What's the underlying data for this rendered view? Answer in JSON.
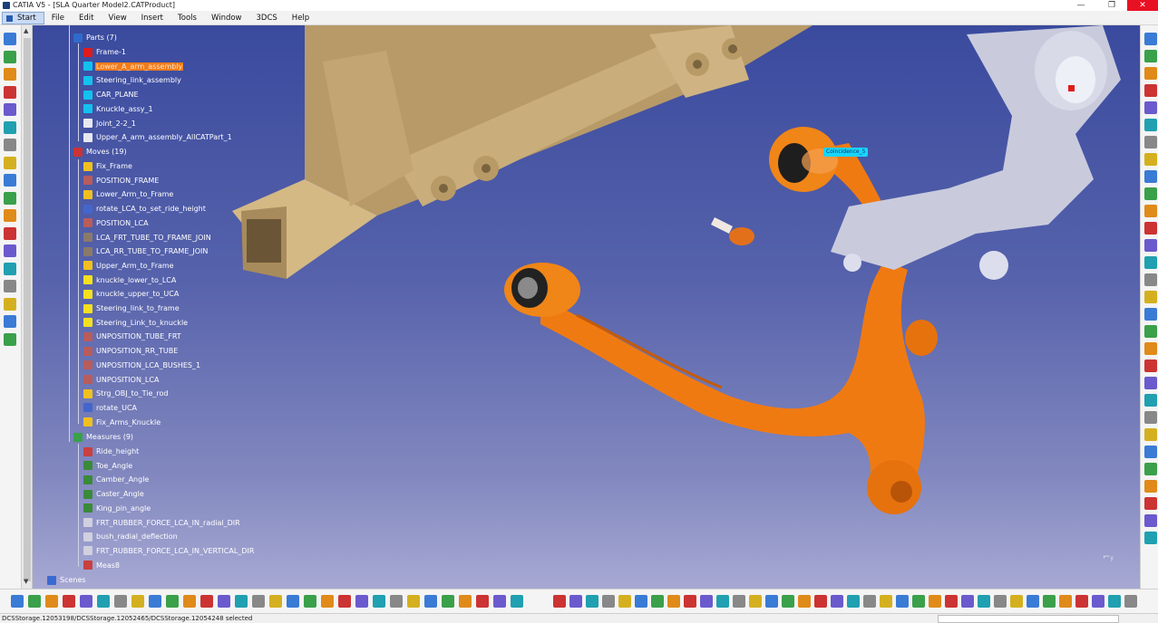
{
  "window": {
    "title": "CATIA V5 - [SLA Quarter Model2.CATProduct]",
    "controls": {
      "minimize": "—",
      "restore": "❐",
      "close": "✕"
    }
  },
  "menu": {
    "items": [
      "Start",
      "File",
      "Edit",
      "View",
      "Insert",
      "Tools",
      "Window",
      "3DCS",
      "Help"
    ]
  },
  "tree": {
    "parts": {
      "label": "Parts (7)",
      "items": [
        {
          "label": "Frame-1",
          "color": "#e01b1b"
        },
        {
          "label": "Lower_A_arm_assembly",
          "color": "#13c1ee",
          "selected": true
        },
        {
          "label": "Steering_link_assembly",
          "color": "#13c1ee"
        },
        {
          "label": "CAR_PLANE",
          "color": "#13c1ee"
        },
        {
          "label": "Knuckle_assy_1",
          "color": "#13c1ee"
        },
        {
          "label": "Joint_2-2_1",
          "color": "#e8e8f0"
        },
        {
          "label": "Upper_A_arm_assembly_AllCATPart_1",
          "color": "#e8e8f0"
        }
      ]
    },
    "moves": {
      "label": "Moves (19)",
      "items": [
        {
          "label": "Fix_Frame",
          "color": "#f0c020"
        },
        {
          "label": "POSITION_FRAME",
          "color": "#b85c5c"
        },
        {
          "label": "Lower_Arm_to_Frame",
          "color": "#f0c020"
        },
        {
          "label": "rotate_LCA_to_set_ride_height",
          "color": "#4466cc"
        },
        {
          "label": "POSITION_LCA",
          "color": "#b85c5c"
        },
        {
          "label": "LCA_FRT_TUBE_TO_FRAME_JOIN",
          "color": "#8a7a6a"
        },
        {
          "label": "LCA_RR_TUBE_TO_FRAME_JOIN",
          "color": "#8a7a6a"
        },
        {
          "label": "Upper_Arm_to_Frame",
          "color": "#f0c020"
        },
        {
          "label": "knuckle_lower_to_LCA",
          "color": "#f5e020"
        },
        {
          "label": "knuckle_upper_to_UCA",
          "color": "#f5e020"
        },
        {
          "label": "Steering_link_to_frame",
          "color": "#f5e020"
        },
        {
          "label": "Steering_Link_to_knuckle",
          "color": "#f5e020"
        },
        {
          "label": "UNPOSITION_TUBE_FRT",
          "color": "#b85c5c"
        },
        {
          "label": "UNPOSITION_RR_TUBE",
          "color": "#b85c5c"
        },
        {
          "label": "UNPOSITION_LCA_BUSHES_1",
          "color": "#b85c5c"
        },
        {
          "label": "UNPOSITION_LCA",
          "color": "#b85c5c"
        },
        {
          "label": "Strg_OBJ_to_Tie_rod",
          "color": "#f0c020"
        },
        {
          "label": "rotate_UCA",
          "color": "#4466cc"
        },
        {
          "label": "Fix_Arms_Knuckle",
          "color": "#f0c020"
        }
      ]
    },
    "measures": {
      "label": "Measures (9)",
      "items": [
        {
          "label": "Ride_height",
          "color": "#c84040"
        },
        {
          "label": "Toe_Angle",
          "color": "#3a8a3a"
        },
        {
          "label": "Camber_Angle",
          "color": "#3a8a3a"
        },
        {
          "label": "Caster_Angle",
          "color": "#3a8a3a"
        },
        {
          "label": "King_pin_angle",
          "color": "#3a8a3a"
        },
        {
          "label": "FRT_RUBBER_FORCE_LCA_IN_radial_DIR",
          "color": "#d0d0e0"
        },
        {
          "label": "bush_radial_deflection",
          "color": "#d0d0e0"
        },
        {
          "label": "FRT_RUBBER_FORCE_LCA_IN_VERTICAL_DIR",
          "color": "#d0d0e0"
        },
        {
          "label": "Meas8",
          "color": "#c84040"
        }
      ]
    },
    "scenes_label": "Scenes"
  },
  "viewport": {
    "tag_label": "Coincidence_5",
    "compass_label": "y"
  },
  "status": {
    "selection_text": "DCSStorage.12053198/DCSStorage.12052465/DCSStorage.12054248 selected"
  },
  "colors": {
    "arm_orange": "#f07a12",
    "frame_tan": "#c9ad7b",
    "knuckle_gray": "#c9cbdd",
    "selection_highlight": "#f27c1c",
    "viewport_top": "#3a4a9e",
    "viewport_bottom": "#a7a9d3"
  }
}
